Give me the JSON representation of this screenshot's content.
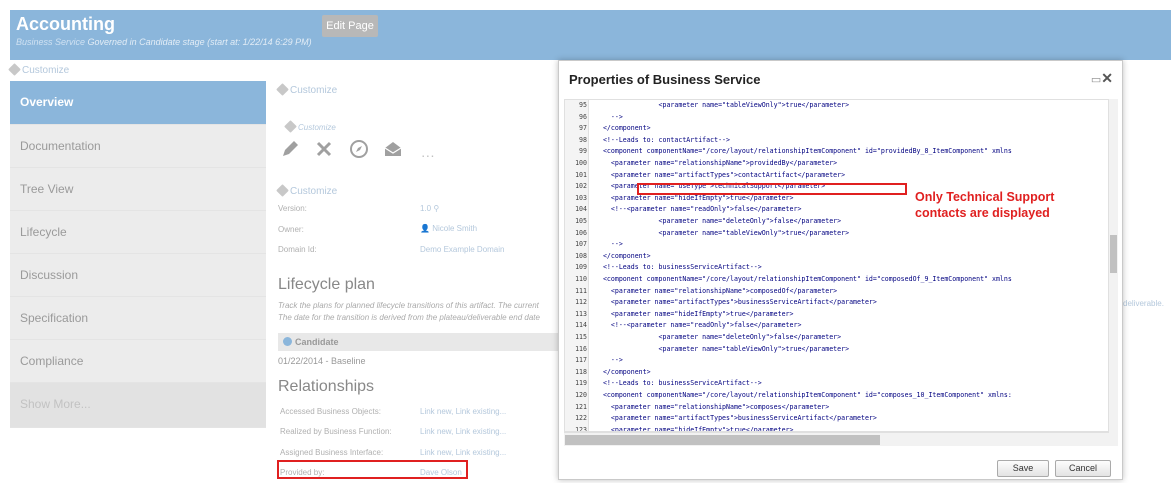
{
  "header": {
    "title": "Accounting",
    "subtitle_type": "Business Service",
    "subtitle_status": "Governed in Candidate stage (start at: 1/22/14 6:29 PM)",
    "edit_button": "Edit Page"
  },
  "customize_label": "Customize",
  "sidebar": {
    "items": [
      {
        "label": "Overview"
      },
      {
        "label": "Documentation"
      },
      {
        "label": "Tree View"
      },
      {
        "label": "Lifecycle"
      },
      {
        "label": "Discussion"
      },
      {
        "label": "Specification"
      },
      {
        "label": "Compliance"
      },
      {
        "label": "Show More..."
      }
    ]
  },
  "details": {
    "version_label": "Version:",
    "version_value": "1.0",
    "owner_label": "Owner:",
    "owner_value": "Nicole Smith",
    "domain_label": "Domain Id:",
    "domain_value": "Demo Example Domain"
  },
  "lifecycle_plan": {
    "heading": "Lifecycle plan",
    "desc_line1": "Track the plans for planned lifecycle transitions of this artifact. The current",
    "desc_line2": "The date for the transition is derived from the plateau/deliverable end date",
    "stage": "Candidate",
    "baseline": "01/22/2014 - Baseline"
  },
  "relationships": {
    "heading": "Relationships",
    "rows": [
      {
        "label": "Accessed Business Objects:",
        "value": "Link new, Link existing..."
      },
      {
        "label": "Realized by Business Function:",
        "value": "Link new, Link existing..."
      },
      {
        "label": "Assigned Business Interface:",
        "value": "Link new, Link existing..."
      },
      {
        "label": "Provided by:",
        "value": "Dave Olson"
      }
    ]
  },
  "right_link": "deliverable.",
  "dialog": {
    "title": "Properties of Business Service",
    "annotation": "Only Technical Support contacts are displayed",
    "save": "Save",
    "cancel": "Cancel",
    "code_lines": [
      {
        "n": "95",
        "t": "                <parameter name=\"tableViewOnly\">true</parameter>"
      },
      {
        "n": "96",
        "t": "    -->"
      },
      {
        "n": "97",
        "t": "  </component>"
      },
      {
        "n": "98",
        "t": "  <!--Leads to: contactArtifact-->"
      },
      {
        "n": "99",
        "t": "  <component componentName=\"/core/layout/relationshipItemComponent\" id=\"providedBy_8_ItemComponent\" xmlns"
      },
      {
        "n": "100",
        "t": "    <parameter name=\"relationshipName\">providedBy</parameter>"
      },
      {
        "n": "101",
        "t": "    <parameter name=\"artifactTypes\">contactArtifact</parameter>"
      },
      {
        "n": "102",
        "t": "    <parameter name=\"useType\">technicalSupport</parameter>"
      },
      {
        "n": "103",
        "t": "    <parameter name=\"hideIfEmpty\">true</parameter>"
      },
      {
        "n": "104",
        "t": "    <!--<parameter name=\"readOnly\">false</parameter>"
      },
      {
        "n": "105",
        "t": "                <parameter name=\"deleteOnly\">false</parameter>"
      },
      {
        "n": "106",
        "t": "                <parameter name=\"tableViewOnly\">true</parameter>"
      },
      {
        "n": "107",
        "t": "    -->"
      },
      {
        "n": "108",
        "t": "  </component>"
      },
      {
        "n": "109",
        "t": "  <!--Leads to: businessServiceArtifact-->"
      },
      {
        "n": "110",
        "t": "  <component componentName=\"/core/layout/relationshipItemComponent\" id=\"composedOf_9_ItemComponent\" xmlns"
      },
      {
        "n": "111",
        "t": "    <parameter name=\"relationshipName\">composedOf</parameter>"
      },
      {
        "n": "112",
        "t": "    <parameter name=\"artifactTypes\">businessServiceArtifact</parameter>"
      },
      {
        "n": "113",
        "t": "    <parameter name=\"hideIfEmpty\">true</parameter>"
      },
      {
        "n": "114",
        "t": "    <!--<parameter name=\"readOnly\">false</parameter>"
      },
      {
        "n": "115",
        "t": "                <parameter name=\"deleteOnly\">false</parameter>"
      },
      {
        "n": "116",
        "t": "                <parameter name=\"tableViewOnly\">true</parameter>"
      },
      {
        "n": "117",
        "t": "    -->"
      },
      {
        "n": "118",
        "t": "  </component>"
      },
      {
        "n": "119",
        "t": "  <!--Leads to: businessServiceArtifact-->"
      },
      {
        "n": "120",
        "t": "  <component componentName=\"/core/layout/relationshipItemComponent\" id=\"composes_10_ItemComponent\" xmlns:"
      },
      {
        "n": "121",
        "t": "    <parameter name=\"relationshipName\">composes</parameter>"
      },
      {
        "n": "122",
        "t": "    <parameter name=\"artifactTypes\">businessServiceArtifact</parameter>"
      },
      {
        "n": "123",
        "t": "    <parameter name=\"hideIfEmpty\">true</parameter>"
      }
    ]
  },
  "icons": {
    "edit": "pencil-icon",
    "delete": "x-icon",
    "compass": "compass-icon",
    "mail": "envelope-icon",
    "more": "ellipsis-icon",
    "maximize": "maximize-icon",
    "close": "close-icon"
  },
  "colors": {
    "accent": "#8bb6db",
    "annotation": "#e02020",
    "link": "#b4c8dc"
  }
}
